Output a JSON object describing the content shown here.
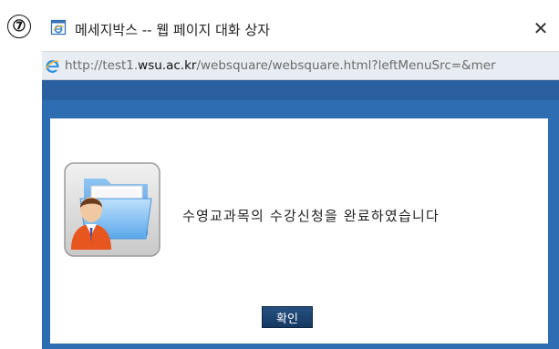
{
  "step_marker": "⑦",
  "window": {
    "title": "메세지박스 -- 웹 페이지 대화 상자",
    "close_glyph": "✕",
    "title_icon": "ie-page-icon"
  },
  "address": {
    "icon": "ie-icon",
    "scheme": "http://test1.",
    "host": "wsu.ac.kr",
    "path": "/websquare/websquare.html?leftMenuSrc=&mer"
  },
  "dialog": {
    "icon": "folder-user-icon",
    "message": "수영교과목의 수강신청을 완료하였습니다",
    "ok_label": "확인"
  },
  "colors": {
    "content_blue": "#2f6db3",
    "button_navy": "#1d4470"
  }
}
